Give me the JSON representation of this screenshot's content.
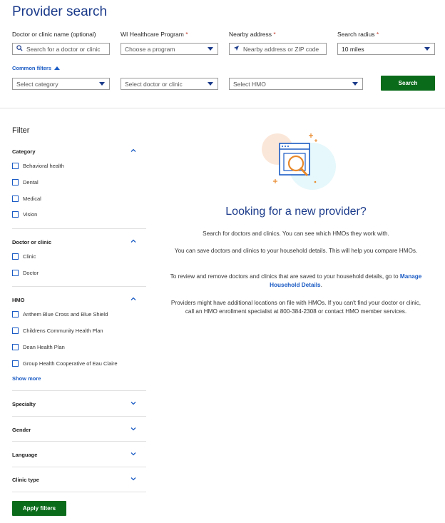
{
  "page": {
    "title": "Provider search"
  },
  "search": {
    "name_label": "Doctor or clinic name (optional)",
    "name_placeholder": "Search for a doctor or clinic",
    "program_label": "WI Healthcare Program",
    "program_placeholder": "Choose a program",
    "address_label": "Nearby address",
    "address_placeholder": "Nearby address or ZIP code",
    "radius_label": "Search radius",
    "radius_value": "10 miles",
    "required_mark": "*",
    "common_filters_label": "Common filters",
    "category_placeholder": "Select category",
    "doctor_placeholder": "Select doctor or clinic",
    "hmo_placeholder": "Select HMO",
    "search_button": "Search"
  },
  "filter": {
    "title": "Filter",
    "category": {
      "label": "Category",
      "items": [
        "Behavioral health",
        "Dental",
        "Medical",
        "Vision"
      ]
    },
    "doctor_clinic": {
      "label": "Doctor or clinic",
      "items": [
        "Clinic",
        "Doctor"
      ]
    },
    "hmo": {
      "label": "HMO",
      "items": [
        "Anthem Blue Cross and Blue Shield",
        "Childrens Community Health Plan",
        "Dean Health Plan",
        "Group Health Cooperative of Eau Claire"
      ],
      "show_more": "Show more"
    },
    "specialty": "Specialty",
    "gender": "Gender",
    "language": "Language",
    "clinic_type": "Clinic type",
    "apply_button": "Apply filters"
  },
  "empty_state": {
    "title": "Looking for a new provider?",
    "p1": "Search for doctors and clinics. You can see which HMOs they work with.",
    "p2": "You can save doctors and clinics to your household details. This will help you compare HMOs.",
    "p3_before": "To review and remove doctors and clinics that are saved to your household details, go to",
    "p3_link": "Manage Household Details",
    "p3_after": ".",
    "p4": "Providers might have additional locations on file with HMOs. If you can't find your doctor or clinic, call an HMO enrollment specialist at 800-384-2308 or contact HMO member services."
  },
  "colors": {
    "brand": "#1a3a8a",
    "link": "#1a5bc4",
    "button": "#0a6b1a",
    "required": "#c0392b"
  }
}
